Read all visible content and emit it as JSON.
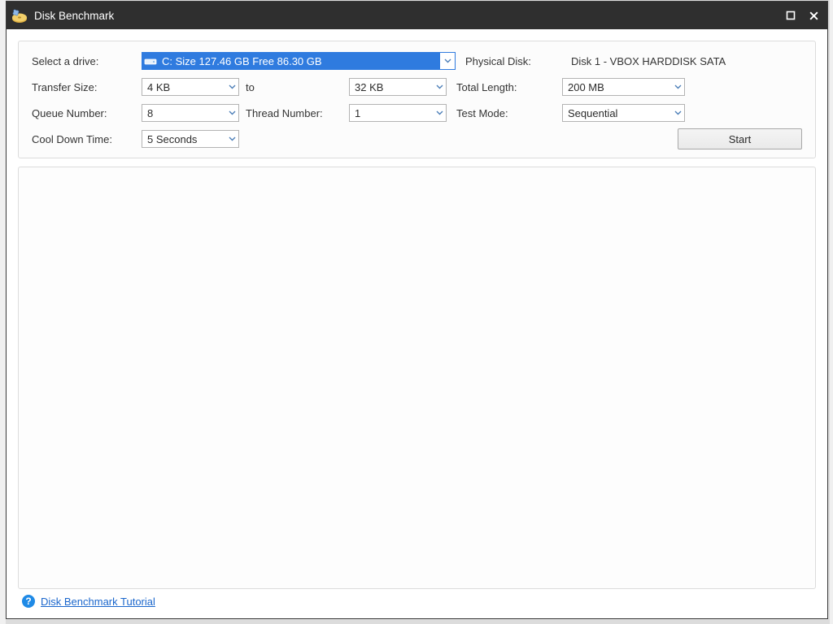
{
  "window": {
    "title": "Disk Benchmark"
  },
  "labels": {
    "select_drive": "Select a drive:",
    "physical_disk": "Physical Disk:",
    "transfer_size": "Transfer Size:",
    "to": "to",
    "total_length": "Total Length:",
    "queue_number": "Queue Number:",
    "thread_number": "Thread Number:",
    "test_mode": "Test Mode:",
    "cool_down_time": "Cool Down Time:",
    "start": "Start",
    "tutorial": "Disk Benchmark Tutorial"
  },
  "values": {
    "drive": "C:  Size 127.46 GB  Free 86.30 GB",
    "physical_disk": "Disk 1 - VBOX HARDDISK SATA",
    "transfer_from": "4 KB",
    "transfer_to": "32 KB",
    "total_length": "200 MB",
    "queue_number": "8",
    "thread_number": "1",
    "test_mode": "Sequential",
    "cool_down": "5 Seconds"
  }
}
